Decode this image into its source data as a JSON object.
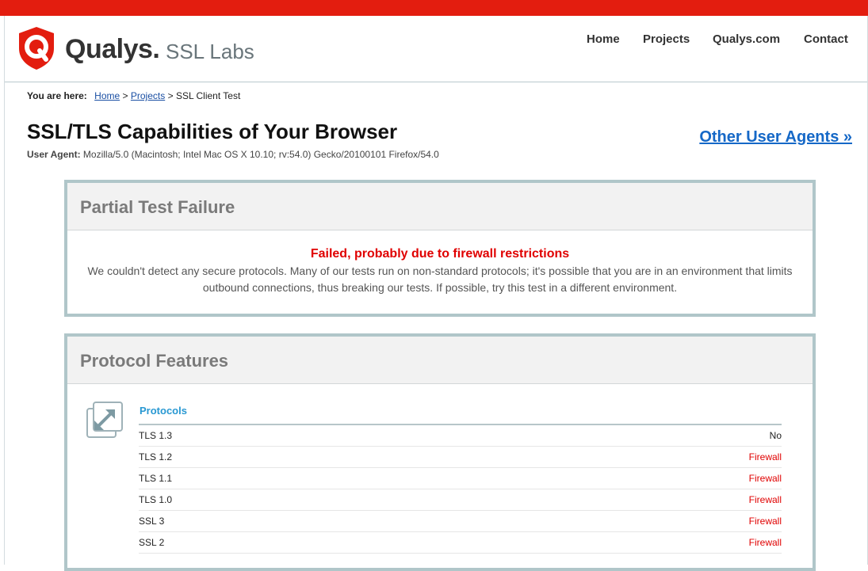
{
  "header": {
    "brand": "Qualys.",
    "product": "SSL Labs",
    "nav": [
      "Home",
      "Projects",
      "Qualys.com",
      "Contact"
    ]
  },
  "breadcrumb": {
    "label": "You are here:",
    "home": "Home",
    "sep1": ">",
    "projects": "Projects",
    "sep2": ">",
    "current": "SSL Client Test"
  },
  "page": {
    "title": "SSL/TLS Capabilities of Your Browser",
    "ua_label": "User Agent:",
    "ua_value": "Mozilla/5.0 (Macintosh; Intel Mac OS X 10.10; rv:54.0) Gecko/20100101 Firefox/54.0",
    "other_agents": "Other User Agents »"
  },
  "failure_panel": {
    "title": "Partial Test Failure",
    "error_title": "Failed, probably due to firewall restrictions",
    "error_text": "We couldn't detect any secure protocols. Many of our tests run on non-standard protocols; it's possible that you are in an environment that limits outbound connections, thus breaking our tests. If possible, try this test in a different environment."
  },
  "features_panel": {
    "title": "Protocol Features",
    "section_title": "Protocols",
    "rows": [
      {
        "name": "TLS 1.3",
        "value": "No",
        "status": "normal"
      },
      {
        "name": "TLS 1.2",
        "value": "Firewall",
        "status": "error"
      },
      {
        "name": "TLS 1.1",
        "value": "Firewall",
        "status": "error"
      },
      {
        "name": "TLS 1.0",
        "value": "Firewall",
        "status": "error"
      },
      {
        "name": "SSL 3",
        "value": "Firewall",
        "status": "error"
      },
      {
        "name": "SSL 2",
        "value": "Firewall",
        "status": "error"
      }
    ]
  },
  "colors": {
    "brand_red": "#e31d0f",
    "link_blue": "#1568c7",
    "error_red": "#e00000",
    "panel_border": "#b0c6c9"
  }
}
